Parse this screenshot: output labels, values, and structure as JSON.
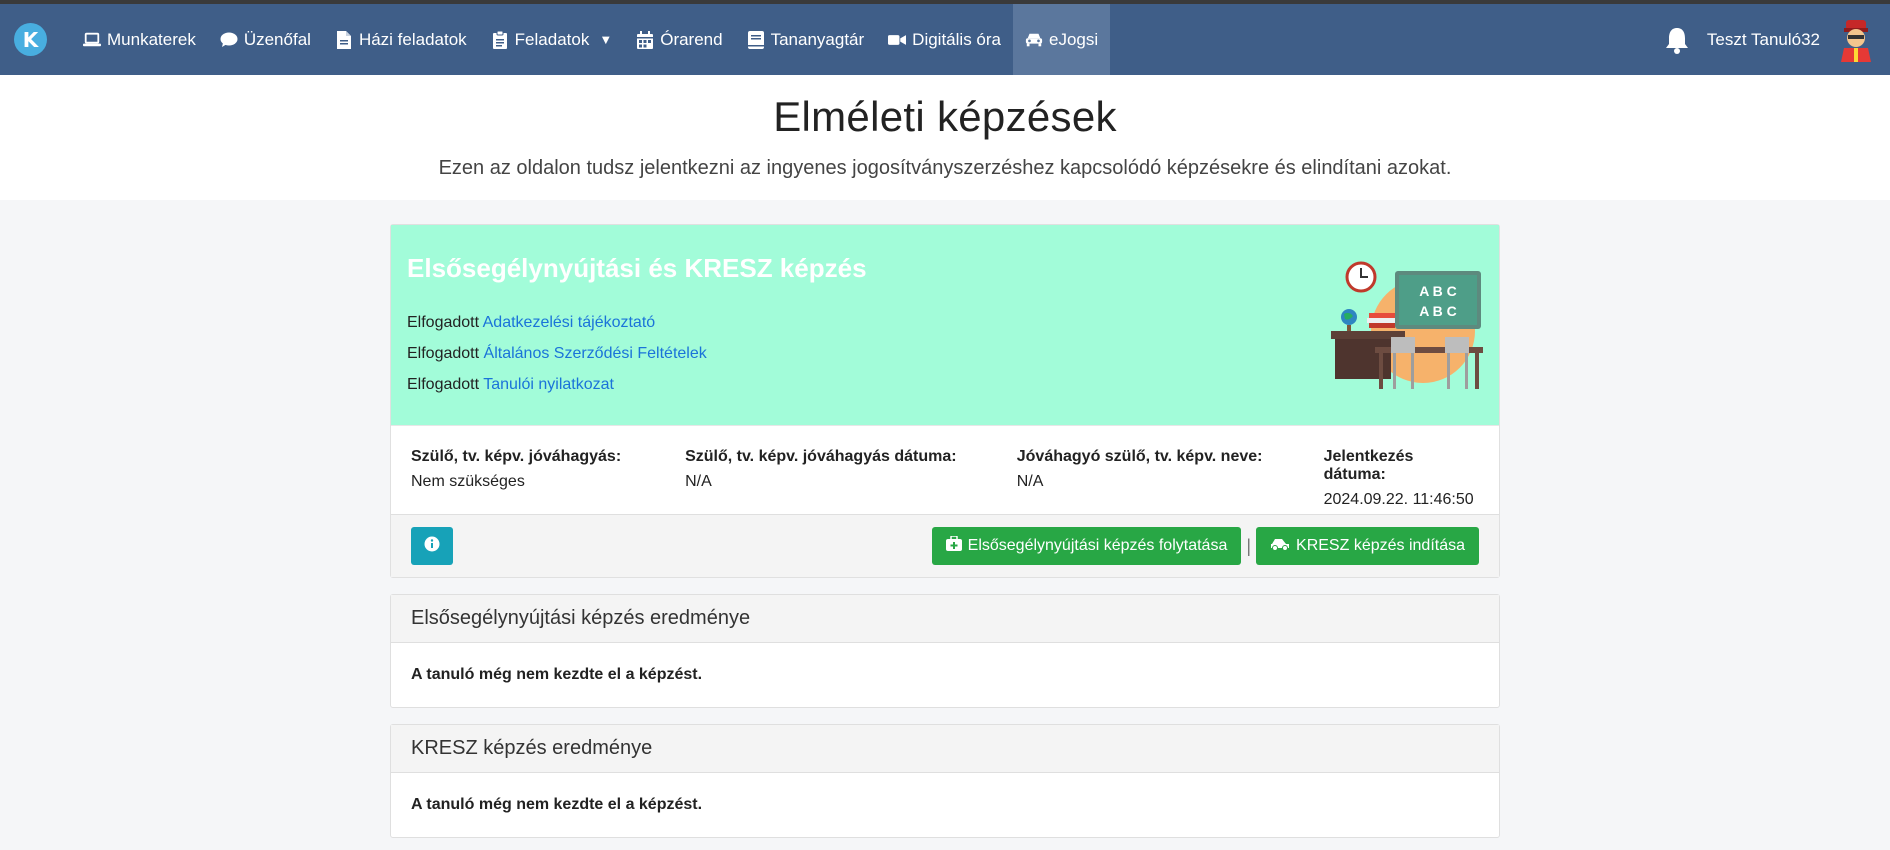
{
  "nav": {
    "logo_letter": "K",
    "items": [
      {
        "label": "Munkaterek",
        "icon": "laptop-icon"
      },
      {
        "label": "Üzenőfal",
        "icon": "comment-icon"
      },
      {
        "label": "Házi feladatok",
        "icon": "file-icon"
      },
      {
        "label": "Feladatok",
        "icon": "clipboard-icon"
      },
      {
        "label": "Órarend",
        "icon": "calendar-icon"
      },
      {
        "label": "Tananyagtár",
        "icon": "book-icon"
      },
      {
        "label": "Digitális óra",
        "icon": "video-icon"
      },
      {
        "label": "eJogsi",
        "icon": "car-icon"
      }
    ],
    "username": "Teszt Tanuló32"
  },
  "hero": {
    "title": "Elméleti képzések",
    "subtitle": "Ezen az oldalon tudsz jelentkezni az ingyenes jogosítványszerzéshez kapcsolódó képzésekre és elindítani azokat."
  },
  "training": {
    "title": "Elsősegélynyújtási és KRESZ képzés",
    "consents": [
      {
        "prefix": "Elfogadott",
        "link": "Adatkezelési tájékoztató"
      },
      {
        "prefix": "Elfogadott",
        "link": "Általános Szerződési Feltételek"
      },
      {
        "prefix": "Elfogadott",
        "link": "Tanulói nyilatkozat"
      }
    ],
    "illustration_text": [
      "A B C",
      "A B C"
    ],
    "info": [
      {
        "label": "Szülő, tv. képv. jóváhagyás:",
        "value": "Nem szükséges"
      },
      {
        "label": "Szülő, tv. képv. jóváhagyás dátuma:",
        "value": "N/A"
      },
      {
        "label": "Jóváhagyó szülő, tv. képv. neve:",
        "value": "N/A"
      },
      {
        "label": "Jelentkezés dátuma:",
        "value": "2024.09.22. 11:46:50"
      }
    ],
    "buttons": {
      "first_aid": "Elsősegélynyújtási képzés folytatása",
      "separator": "|",
      "kresz": "KRESZ képzés indítása"
    }
  },
  "results": [
    {
      "title": "Elsősegélynyújtási képzés eredménye",
      "text": "A tanuló még nem kezdte el a képzést."
    },
    {
      "title": "KRESZ képzés eredménye",
      "text": "A tanuló még nem kezdte el a képzést."
    }
  ],
  "colors": {
    "navbar": "#3f5e88",
    "card_header": "#a2fcd9",
    "button_green": "#28a745",
    "button_info": "#17a2b8",
    "link": "#1a73d9"
  }
}
